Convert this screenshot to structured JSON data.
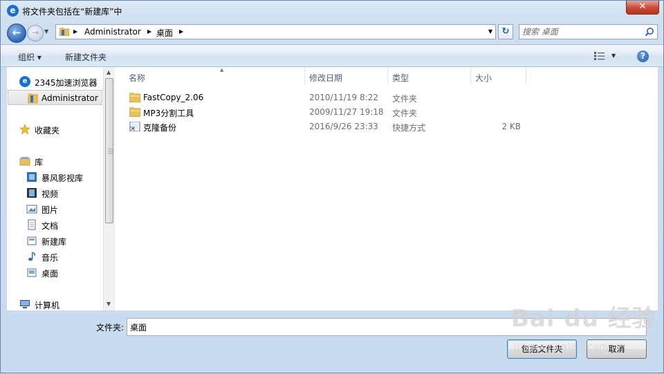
{
  "window": {
    "title": "将文件夹包括在“新建库”中",
    "close_label": "✕"
  },
  "nav": {
    "breadcrumbs": [
      "Administrator",
      "桌面"
    ],
    "search_placeholder": "搜索 桌面"
  },
  "toolbar": {
    "organize_label": "组织 ▾",
    "new_folder_label": "新建文件夹",
    "help_label": "?"
  },
  "sidebar": {
    "items": [
      {
        "label": "2345加速浏览器",
        "icon": "browser-icon"
      },
      {
        "label": "Administrator",
        "icon": "user-folder-icon",
        "selected": true
      },
      {
        "label": "收藏夹",
        "icon": "star-icon"
      },
      {
        "label": "库",
        "icon": "library-icon"
      },
      {
        "label": "暴风影视库",
        "icon": "video-library-icon"
      },
      {
        "label": "视频",
        "icon": "film-icon"
      },
      {
        "label": "图片",
        "icon": "picture-icon"
      },
      {
        "label": "文档",
        "icon": "document-icon"
      },
      {
        "label": "新建库",
        "icon": "library-icon"
      },
      {
        "label": "音乐",
        "icon": "music-icon"
      },
      {
        "label": "桌面",
        "icon": "desktop-icon"
      },
      {
        "label": "计算机",
        "icon": "computer-icon"
      }
    ]
  },
  "filelist": {
    "columns": [
      "名称",
      "修改日期",
      "类型",
      "大小"
    ],
    "rows": [
      {
        "name": "FastCopy_2.06",
        "date": "2010/11/19 8:22",
        "type": "文件夹",
        "size": "",
        "icon": "folder-icon"
      },
      {
        "name": "MP3分割工具",
        "date": "2009/11/27 19:18",
        "type": "文件夹",
        "size": "",
        "icon": "folder-icon"
      },
      {
        "name": "克隆备份",
        "date": "2016/9/26 23:33",
        "type": "快捷方式",
        "size": "2 KB",
        "icon": "shortcut-icon"
      }
    ]
  },
  "footer": {
    "folder_label": "文件夹:",
    "folder_value": "桌面",
    "include_button": "包括文件夹",
    "cancel_button": "取消"
  },
  "watermark": {
    "brand": "Bai du 经验",
    "url": "jingyan.baidu.com"
  },
  "colors": {
    "accent": "#1b6fd0",
    "folder": "#e9c15a",
    "close": "#c94a35"
  }
}
